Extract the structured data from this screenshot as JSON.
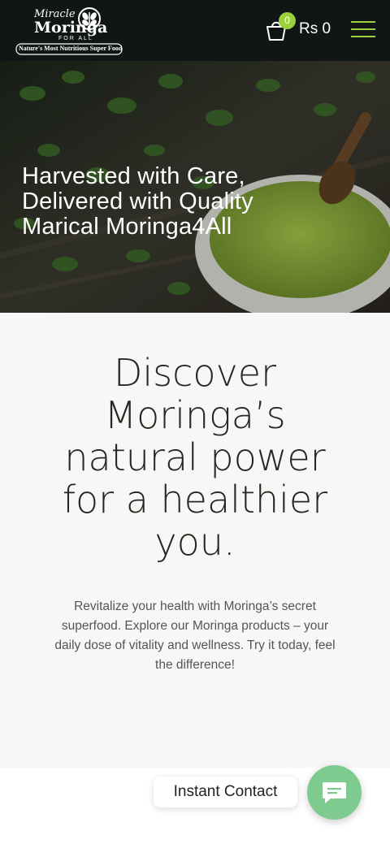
{
  "header": {
    "logo": {
      "line1": "Miracle",
      "line2": "Moringa",
      "line3": "FOR ALL",
      "tagline": "Nature's Most Nutritious Super Food"
    },
    "cart": {
      "count": "0",
      "total": "Rs 0"
    },
    "menu_icon": "hamburger-icon",
    "accent_color": "#9bcf3c"
  },
  "hero": {
    "title_lines": [
      "Harvested with Care,",
      "Delivered with Quality",
      "Marical Moringa4All"
    ]
  },
  "discover": {
    "heading_lines": [
      "Discover",
      "Moringa’s",
      "natural power",
      "for a healthier",
      "you."
    ],
    "body_lines": [
      "Revitalize your health with Moringa’s secret",
      "superfood. Explore our Moringa products – your",
      "daily dose of vitality and wellness. Try it today, feel",
      "the difference!"
    ]
  },
  "contact": {
    "label": "Instant Contact",
    "icon": "chat-icon",
    "color": "#7fcb8f"
  }
}
